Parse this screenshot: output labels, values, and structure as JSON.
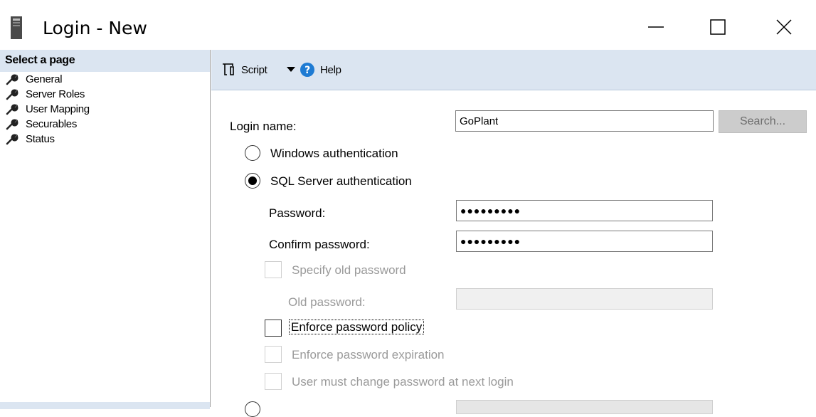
{
  "window": {
    "title": "Login - New",
    "icons": {
      "app": "server-icon",
      "minimize": "minimize-icon",
      "maximize": "maximize-icon",
      "close": "close-icon"
    }
  },
  "sidebar": {
    "header": "Select a page",
    "items": [
      {
        "label": "General",
        "icon": "wrench-icon"
      },
      {
        "label": "Server Roles",
        "icon": "wrench-icon"
      },
      {
        "label": "User Mapping",
        "icon": "wrench-icon"
      },
      {
        "label": "Securables",
        "icon": "wrench-icon"
      },
      {
        "label": "Status",
        "icon": "wrench-icon"
      }
    ]
  },
  "toolbar": {
    "script_label": "Script",
    "help_label": "Help",
    "icons": {
      "script": "script-icon",
      "dropdown": "dropdown-arrow-icon",
      "help": "help-icon"
    }
  },
  "form": {
    "login_name_label": "Login name:",
    "login_name_value": "GoPlant",
    "search_label": "Search...",
    "windows_auth_label": "Windows authentication",
    "sql_auth_label": "SQL Server authentication",
    "selected_auth": "SQL Server authentication",
    "password_label": "Password:",
    "password_value": "●●●●●●●●●",
    "confirm_password_label": "Confirm password:",
    "confirm_password_value": "●●●●●●●●●",
    "specify_old_password_label": "Specify old password",
    "old_password_label": "Old password:",
    "enforce_policy_label": "Enforce password policy",
    "enforce_policy_checked": false,
    "enforce_expiration_label": "Enforce password expiration",
    "must_change_label": "User must change password at next login"
  },
  "colors": {
    "panel_header_bg": "#dbe5f1",
    "disabled_text": "#9a9a9a",
    "help_blue": "#1e7bd3"
  }
}
